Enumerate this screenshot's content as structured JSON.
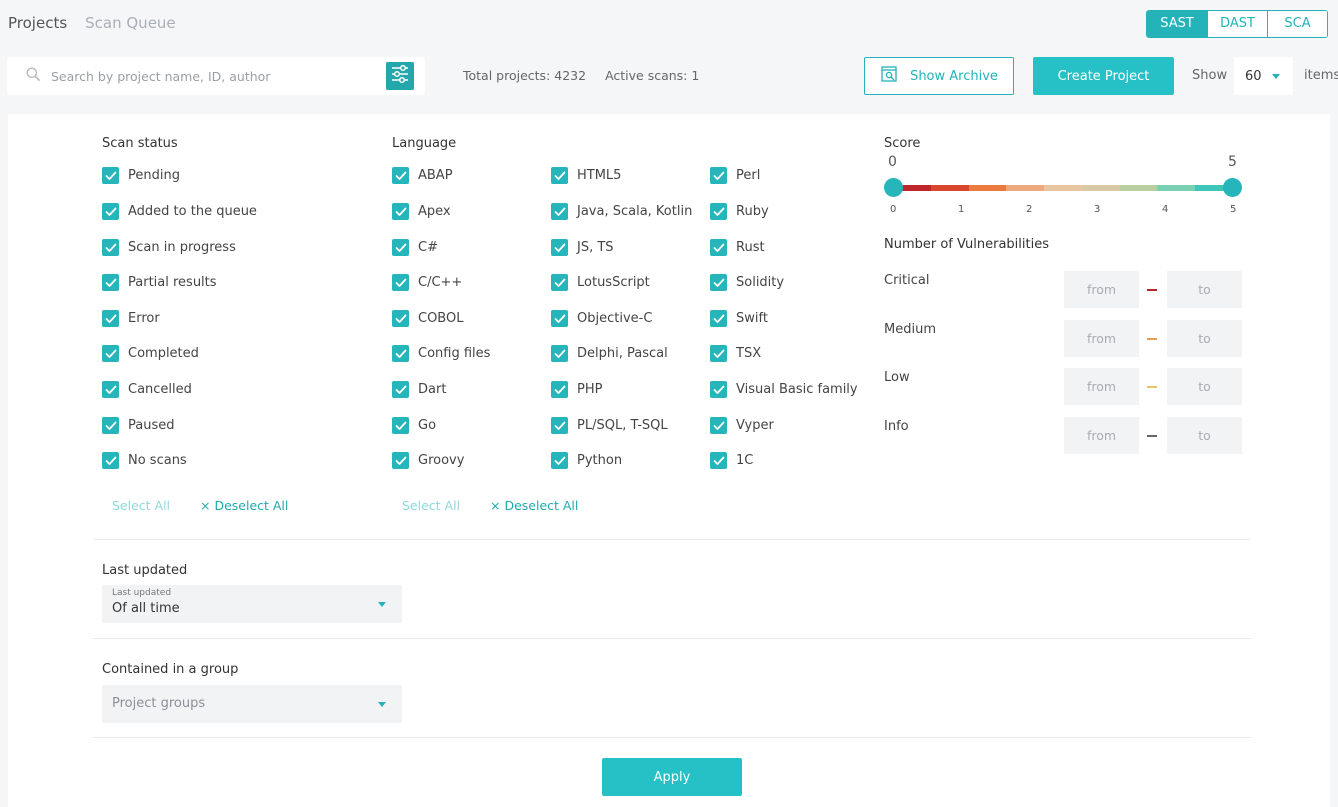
{
  "nav": {
    "projects": "Projects",
    "scan_queue": "Scan Queue"
  },
  "analysis_types": [
    "SAST",
    "DAST",
    "SCA"
  ],
  "search": {
    "placeholder": "Search by project name, ID, author"
  },
  "stats": {
    "total_projects": "Total projects: 4232",
    "active_scans": "Active scans: 1"
  },
  "toolbar": {
    "show_archive": "Show Archive",
    "create_project": "Create Project",
    "show_label": "Show",
    "show_value": "60",
    "items_label": "items"
  },
  "filters": {
    "scan_status": {
      "title": "Scan status",
      "items": [
        "Pending",
        "Added to the queue",
        "Scan in progress",
        "Partial results",
        "Error",
        "Completed",
        "Cancelled",
        "Paused",
        "No scans"
      ],
      "select_all": "Select All",
      "deselect_all": "× Deselect All"
    },
    "language": {
      "title": "Language",
      "items": [
        "ABAP",
        "Apex",
        "C#",
        "C/C++",
        "COBOL",
        "Config files",
        "Dart",
        "Go",
        "Groovy",
        "HTML5",
        "Java, Scala, Kotlin",
        "JS, TS",
        "LotusScript",
        "Objective-C",
        "Delphi, Pascal",
        "PHP",
        "PL/SQL, T-SQL",
        "Python",
        "Perl",
        "Ruby",
        "Rust",
        "Solidity",
        "Swift",
        "TSX",
        "Visual Basic family",
        "Vyper",
        "1C"
      ],
      "select_all": "Select All",
      "deselect_all": "× Deselect All"
    },
    "score": {
      "title": "Score",
      "min_label": "0",
      "max_label": "5",
      "ticks": [
        "0",
        "1",
        "2",
        "3",
        "4",
        "5"
      ],
      "selected_min": 0,
      "selected_max": 5,
      "gradient": [
        "#c0262b",
        "#d9472e",
        "#ea7a3d",
        "#edaa7e",
        "#e8c6a0",
        "#d9c9a6",
        "#b8cf9f",
        "#79d0b3",
        "#3ec7b9"
      ]
    },
    "vulnerabilities": {
      "title": "Number of Vulnerabilities",
      "rows": [
        {
          "label": "Critical",
          "from": "from",
          "to": "to",
          "color": "#b5262a"
        },
        {
          "label": "Medium",
          "from": "from",
          "to": "to",
          "color": "#e89c54"
        },
        {
          "label": "Low",
          "from": "from",
          "to": "to",
          "color": "#e8c56a"
        },
        {
          "label": "Info",
          "from": "from",
          "to": "to",
          "color": "#666666"
        }
      ]
    },
    "last_updated": {
      "title": "Last updated",
      "small_label": "Last updated",
      "value": "Of all time"
    },
    "group": {
      "title": "Contained in a group",
      "placeholder": "Project groups"
    }
  },
  "apply_label": "Apply",
  "accent": "#26c1c6"
}
